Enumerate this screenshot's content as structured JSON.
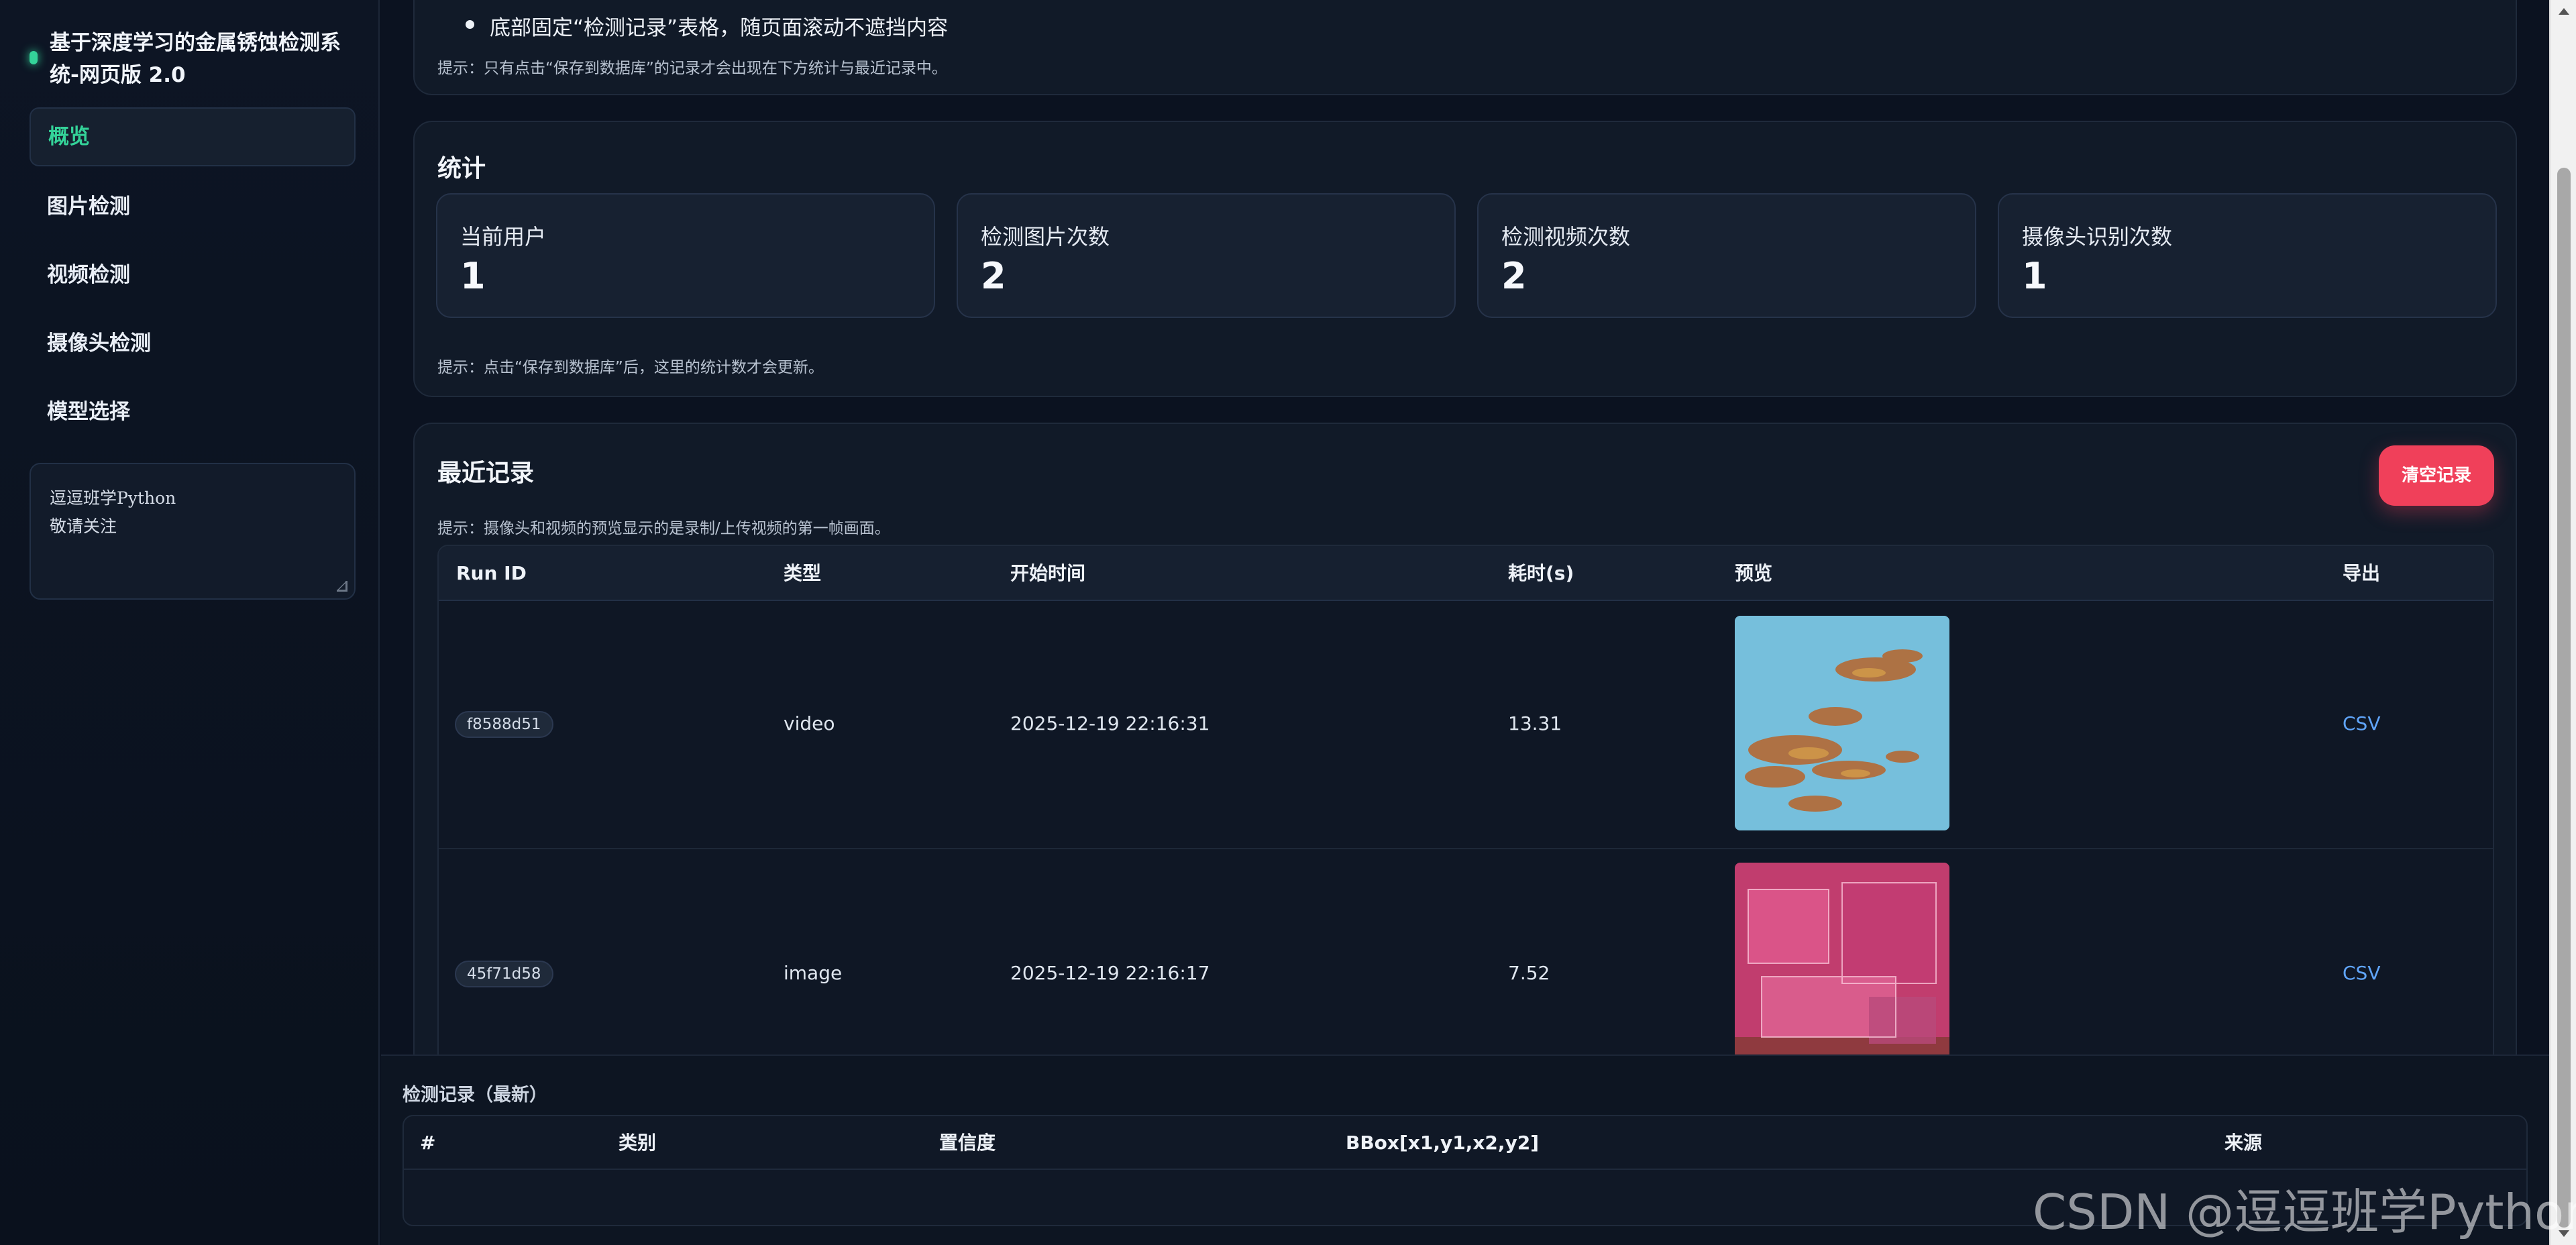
{
  "app": {
    "title": "基于深度学习的金属锈蚀检测系统-网页版 2.0"
  },
  "sidebar": {
    "items": [
      {
        "label": "概览",
        "active": true
      },
      {
        "label": "图片检测"
      },
      {
        "label": "视频检测"
      },
      {
        "label": "摄像头检测"
      },
      {
        "label": "模型选择"
      }
    ],
    "note_lines": [
      "逗逗班学Python",
      "敬请关注"
    ]
  },
  "intro": {
    "bullet": "底部固定“检测记录”表格，随页面滚动不遮挡内容",
    "hint": "提示：只有点击“保存到数据库”的记录才会出现在下方统计与最近记录中。"
  },
  "stats": {
    "title": "统计",
    "cards": [
      {
        "label": "当前用户",
        "value": "1"
      },
      {
        "label": "检测图片次数",
        "value": "2"
      },
      {
        "label": "检测视频次数",
        "value": "2"
      },
      {
        "label": "摄像头识别次数",
        "value": "1"
      }
    ],
    "hint": "提示：点击“保存到数据库”后，这里的统计数才会更新。"
  },
  "recent": {
    "title": "最近记录",
    "clear_button": "清空记录",
    "hint": "提示：摄像头和视频的预览显示的是录制/上传视频的第一帧画面。",
    "columns": [
      "Run ID",
      "类型",
      "开始时间",
      "耗时(s)",
      "预览",
      "导出"
    ],
    "rows": [
      {
        "run_id": "f8588d51",
        "type": "video",
        "start": "2025-12-19 22:16:31",
        "duration": "13.31",
        "export": "CSV"
      },
      {
        "run_id": "45f71d58",
        "type": "image",
        "start": "2025-12-19 22:16:17",
        "duration": "7.52",
        "export": "CSV"
      }
    ]
  },
  "bottom": {
    "title": "检测记录（最新）",
    "columns": [
      "#",
      "类别",
      "置信度",
      "BBox[x1,y1,x2,y2]",
      "来源"
    ]
  },
  "watermark": "CSDN @逗逗班学Python",
  "colors": {
    "accent": "#34d399",
    "danger": "#f0405a",
    "link": "#60a5fa",
    "background": "#0b1220"
  }
}
